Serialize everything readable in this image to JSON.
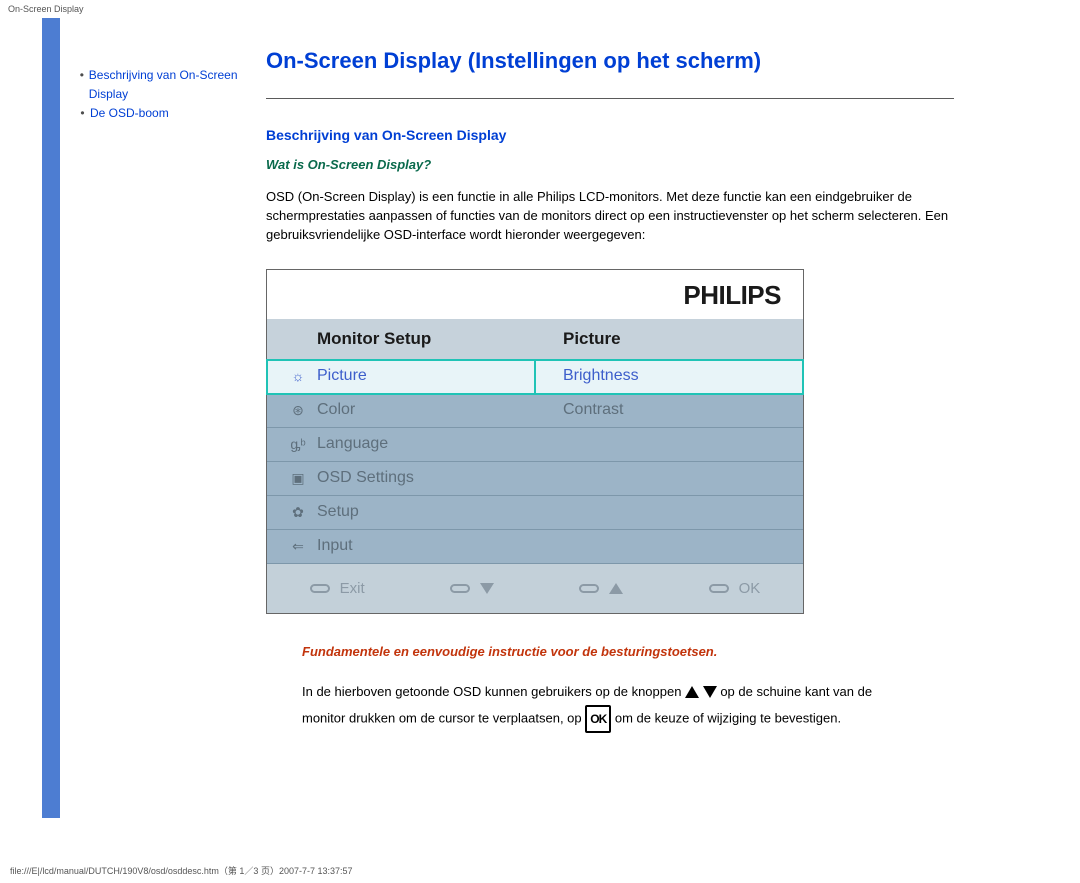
{
  "header_text": "On-Screen Display",
  "sidebar": {
    "items": [
      {
        "label": "Beschrijving van On-Screen Display"
      },
      {
        "label": "De OSD-boom"
      }
    ]
  },
  "page_title": "On-Screen Display (Instellingen op het scherm)",
  "section_heading": "Beschrijving van On-Screen Display",
  "subheading": "Wat is On-Screen Display?",
  "paragraph1": "OSD (On-Screen Display) is een functie in alle Philips LCD-monitors. Met deze functie kan een eindgebruiker de schermprestaties aanpassen of functies van de monitors direct op een instructievenster op het scherm selecteren. Een gebruiksvriendelijke OSD-interface wordt hieronder weergegeven:",
  "osd": {
    "brand": "PHILIPS",
    "left_header": "Monitor Setup",
    "right_header": "Picture",
    "left_items": [
      {
        "icon": "☼",
        "label": "Picture",
        "selected": true
      },
      {
        "icon": "⊛",
        "label": "Color"
      },
      {
        "icon": "ᶃᵇ",
        "label": "Language"
      },
      {
        "icon": "▣",
        "label": "OSD Settings"
      },
      {
        "icon": "✿",
        "label": "Setup"
      },
      {
        "icon": "⇐",
        "label": "Input"
      }
    ],
    "right_items": [
      {
        "label": "Brightness",
        "selected": true
      },
      {
        "label": "Contrast"
      },
      {
        "label": ""
      },
      {
        "label": ""
      },
      {
        "label": ""
      },
      {
        "label": ""
      }
    ],
    "footer": {
      "exit": "Exit",
      "ok": "OK"
    }
  },
  "instruction_line": "Fundamentele en eenvoudige instructie voor de besturingstoetsen.",
  "paragraph2": {
    "part1": "In de hierboven getoonde OSD kunnen gebruikers op de knoppen ",
    "part2": " op de schuine kant van de monitor drukken om de cursor te verplaatsen, op ",
    "part3": " om de keuze of wijziging te bevestigen.",
    "ok_label": "OK"
  },
  "footer_path": "file:///E|/lcd/manual/DUTCH/190V8/osd/osddesc.htm（第 1／3 页）2007-7-7 13:37:57"
}
